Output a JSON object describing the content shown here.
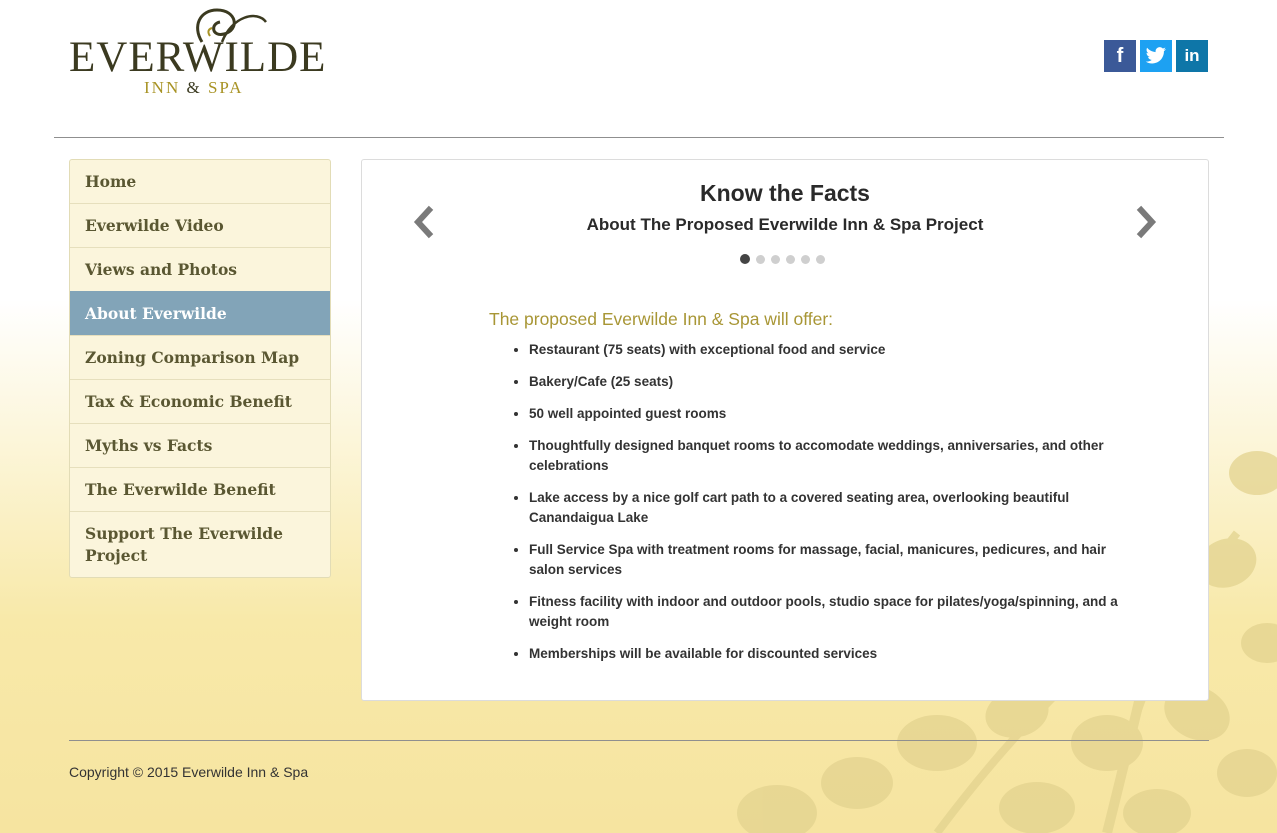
{
  "brand": {
    "logo_main": "EVERWILDE",
    "logo_sub_left": "INN",
    "logo_sub_amp": "&",
    "logo_sub_right": "SPA",
    "accent_gold": "#a89325",
    "dark_olive": "#3b3a20"
  },
  "social": {
    "facebook": "f",
    "twitter": "twitter-bird-icon",
    "linkedin": "in"
  },
  "sidebar": {
    "items": [
      {
        "label": "Home"
      },
      {
        "label": "Everwilde Video"
      },
      {
        "label": "Views and Photos"
      },
      {
        "label": "About Everwilde",
        "active": true
      },
      {
        "label": "Zoning Comparison Map"
      },
      {
        "label": "Tax & Economic Benefit"
      },
      {
        "label": "Myths vs Facts"
      },
      {
        "label": "The Everwilde Benefit"
      },
      {
        "label": "Support The Everwilde Project"
      }
    ],
    "active_color": "#82a4b8"
  },
  "slider": {
    "title": "Know the Facts",
    "subtitle": "About The Proposed Everwilde Inn & Spa Project",
    "slide_count": 6,
    "active_slide": 1
  },
  "content": {
    "heading": "The proposed Everwilde Inn & Spa will offer:",
    "items": [
      "Restaurant (75 seats) with exceptional food and service",
      "Bakery/Cafe (25 seats)",
      "50 well appointed guest rooms",
      "Thoughtfully designed banquet rooms to accomodate weddings, anniversaries, and other celebrations",
      "Lake access by a nice golf cart path to a covered seating area, overlooking beautiful Canandaigua Lake",
      "Full Service Spa with treatment rooms for massage, facial, manicures, pedicures, and hair salon services",
      "Fitness facility with indoor and outdoor pools, studio space for pilates/yoga/spinning, and a weight room",
      "Memberships will be available for discounted services"
    ]
  },
  "footer": {
    "copyright": "Copyright © 2015 Everwilde Inn & Spa"
  }
}
